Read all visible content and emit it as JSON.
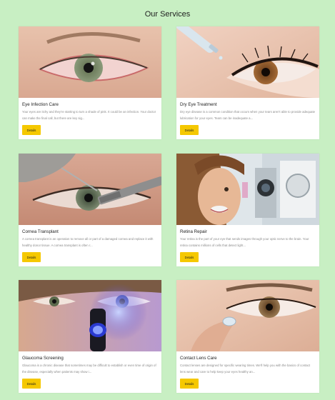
{
  "page": {
    "title": "Our Services"
  },
  "services": [
    {
      "name": "Eye Infection Care",
      "description": "Your eyes are itchy and they're starting to turn a shade of pink. It could be an infection. Your doctor can make the final call, but there are key sig...",
      "button": "Details"
    },
    {
      "name": "Dry Eye Treatment",
      "description": "Dry eye disease is a common condition that occurs when your tears aren't able to provide adequate lubrication for your eyes. Tears can be inadequate a...",
      "button": "Details"
    },
    {
      "name": "Cornea Transplant",
      "description": "A cornea transplant is an operation to remove all or part of a damaged cornea and replace it with healthy donor tissue. A cornea transplant is often r...",
      "button": "Details"
    },
    {
      "name": "Retina Repair",
      "description": "Your retina is the part of your eye that sends images through your optic nerve to the brain. Your retina contains millions of cells that detect light...",
      "button": "Details"
    },
    {
      "name": "Glaucoma Screening",
      "description": "Glaucoma is a chronic disease that sometimes may be difficult to establish or even time of origin of the disease, especially when patients may show i...",
      "button": "Details"
    },
    {
      "name": "Contact Lens Care",
      "description": "Contact lenses are designed for specific wearing times. We'll help you with the basics of contact lens wear and care to help keep your eyes healthy an...",
      "button": "Details"
    }
  ]
}
